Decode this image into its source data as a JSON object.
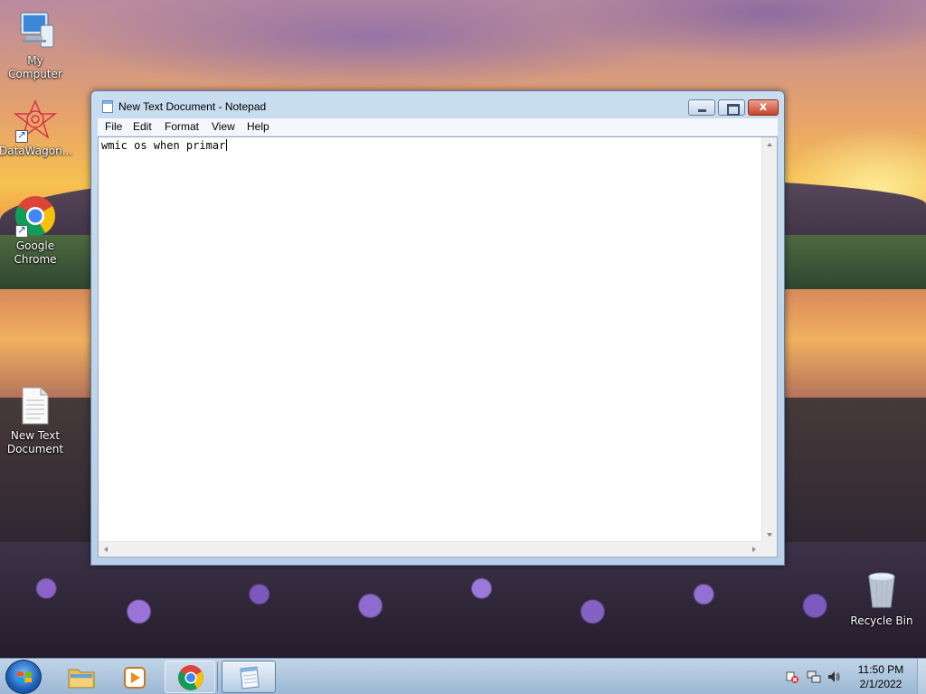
{
  "desktop": {
    "icons": [
      {
        "label": "My Computer"
      },
      {
        "label": "DataWagon..."
      },
      {
        "label": "Google\nChrome"
      },
      {
        "label": "New Text\nDocument"
      },
      {
        "label": "Recycle Bin"
      }
    ]
  },
  "notepad": {
    "title": "New Text Document - Notepad",
    "close_glyph": "x",
    "menu": [
      "File",
      "Edit",
      "Format",
      "View",
      "Help"
    ],
    "content": "wmic os when primar"
  },
  "taskbar": {
    "items": [
      "windows-explorer",
      "windows-media-player",
      "google-chrome",
      "notepad"
    ],
    "clock": {
      "time": "11:50 PM",
      "date": "2/1/2022"
    }
  },
  "colors": {
    "title_bar": "#c9ddf0",
    "close_button": "#c8422a",
    "taskbar": "#b4cbe2"
  }
}
